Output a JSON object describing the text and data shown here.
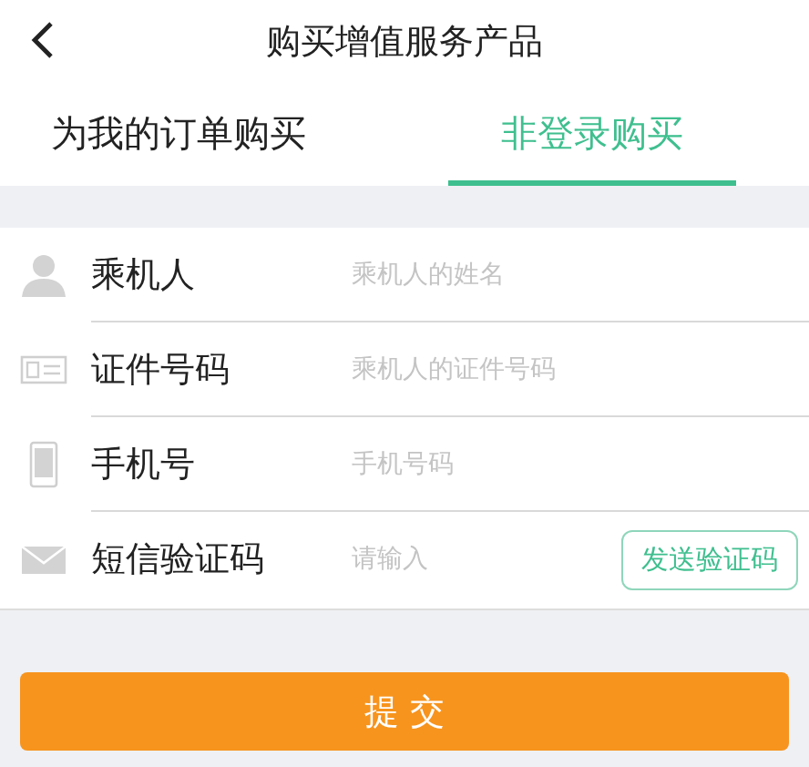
{
  "header": {
    "title": "购买增值服务产品"
  },
  "tabs": [
    {
      "label": "为我的订单购买",
      "selected": false
    },
    {
      "label": "非登录购买",
      "selected": true
    }
  ],
  "form": {
    "fields": [
      {
        "label": "乘机人",
        "placeholder": "乘机人的姓名"
      },
      {
        "label": "证件号码",
        "placeholder": "乘机人的证件号码"
      },
      {
        "label": "手机号",
        "placeholder": "手机号码"
      },
      {
        "label": "短信验证码",
        "placeholder": "请输入",
        "action": "发送验证码"
      }
    ]
  },
  "submit": "提 交"
}
